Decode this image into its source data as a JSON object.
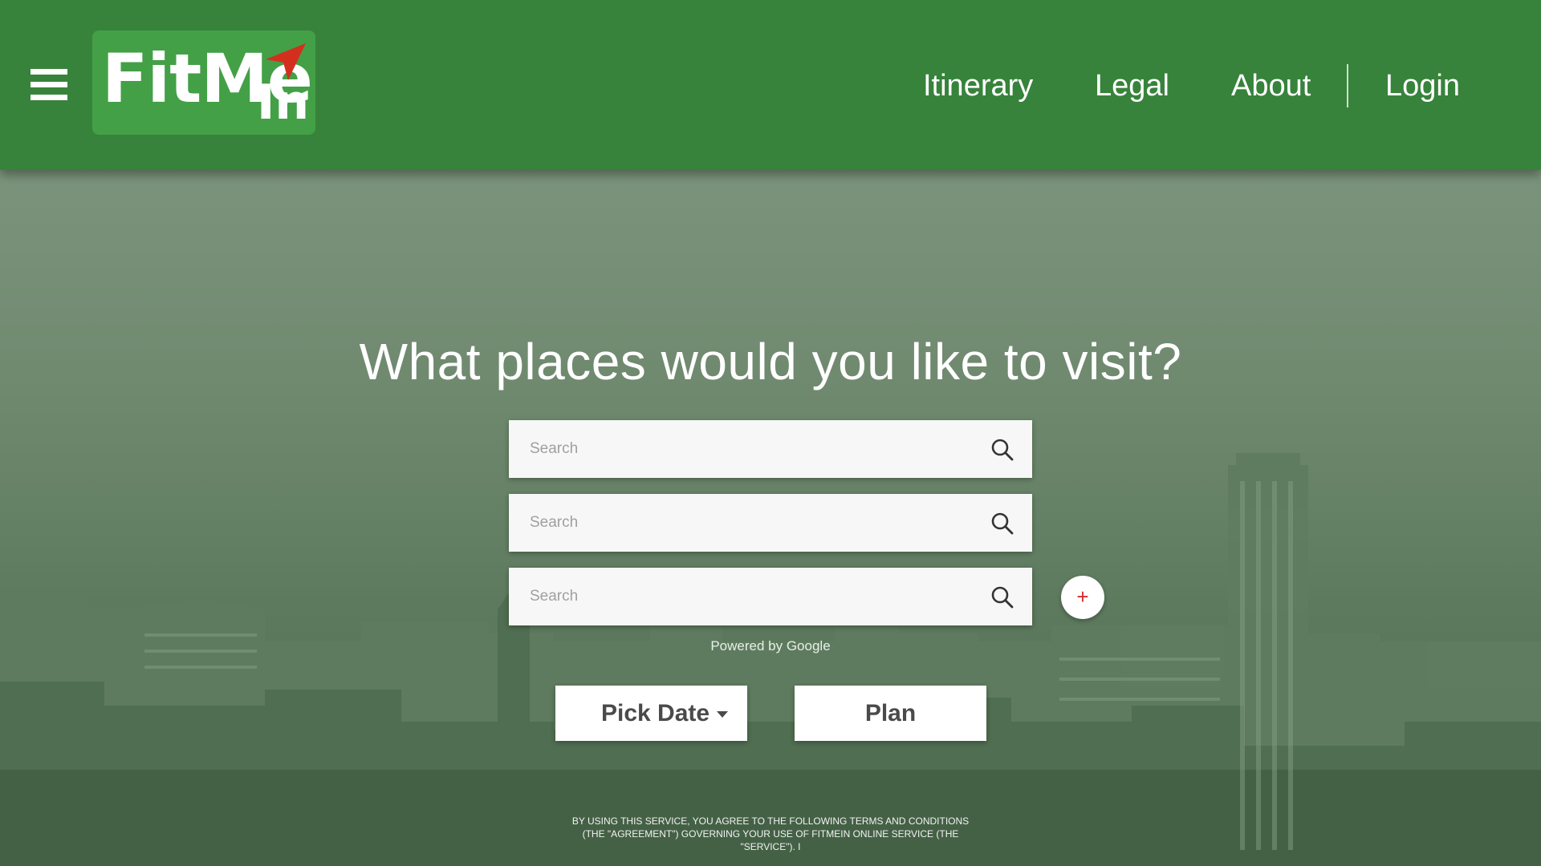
{
  "header": {
    "logo_main": "FitMe",
    "logo_sub": "In",
    "nav": {
      "itinerary": "Itinerary",
      "legal": "Legal",
      "about": "About",
      "login": "Login"
    }
  },
  "main": {
    "headline": "What places would you like to visit?",
    "search_fields": [
      {
        "placeholder": "Search",
        "value": ""
      },
      {
        "placeholder": "Search",
        "value": ""
      },
      {
        "placeholder": "Search",
        "value": ""
      }
    ],
    "add_label": "+",
    "powered_by": "Powered by Google",
    "pick_date_label": "Pick Date",
    "plan_label": "Plan",
    "terms": "BY USING THIS SERVICE, YOU AGREE TO THE FOLLOWING TERMS AND CONDITIONS (THE \"AGREEMENT\") GOVERNING YOUR USE OF FitMeIn ONLINE SERVICE (THE \"SERVICE\"). I"
  },
  "icons": {
    "menu": "hamburger-menu-icon",
    "search": "magnifier-search-icon",
    "dropdown": "caret-down-icon",
    "logo_arrow": "red-arrow-icon"
  },
  "colors": {
    "header_bg": "#37833b",
    "logo_bg": "#43a046",
    "logo_arrow": "#d32f1f",
    "add_plus": "#d32f2f",
    "overlay": "#5d7a5e"
  }
}
